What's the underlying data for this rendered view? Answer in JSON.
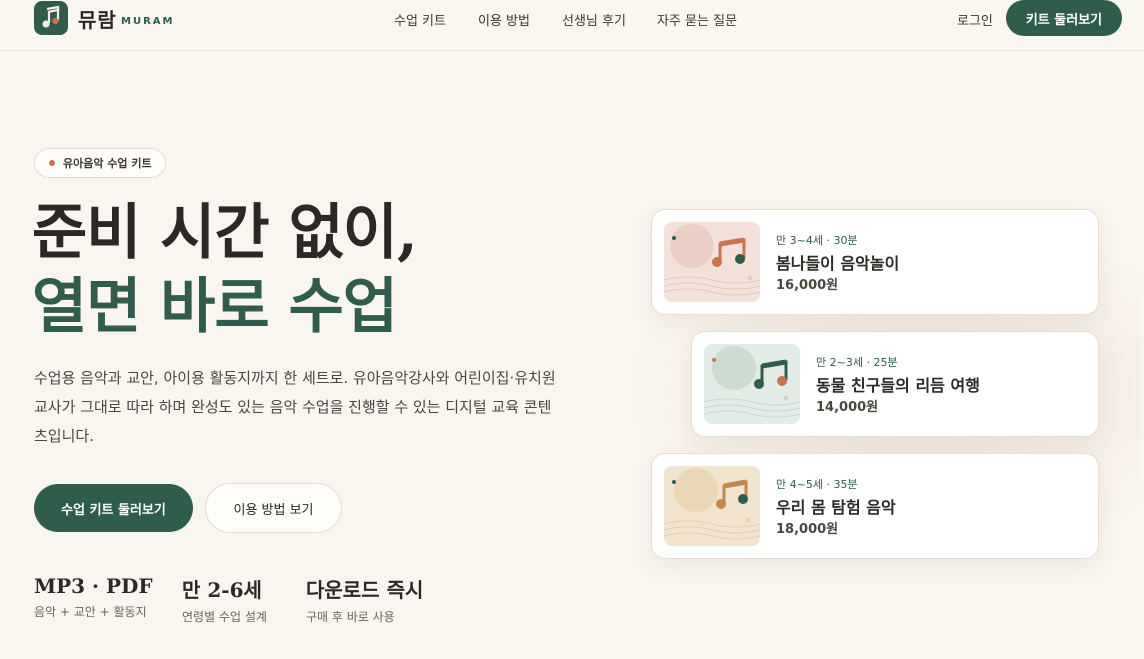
{
  "header": {
    "logo_text": "뮤람",
    "logo_sub": "MURAM",
    "nav": [
      "수업 키트",
      "이용 방법",
      "선생님 후기",
      "자주 묻는 질문"
    ],
    "login_label": "로그인",
    "cta_label": "키트 둘러보기"
  },
  "hero": {
    "badge": "유아음악 수업 키트",
    "title_line1": "준비 시간 없이,",
    "title_line2": "열면 바로 수업",
    "description": "수업용 음악과 교안, 아이용 활동지까지 한 세트로. 유아음악강사와 어린이집·유치원 교사가 그대로 따라 하며 완성도 있는 음악 수업을 진행할 수 있는 디지털 교육 콘텐츠입니다.",
    "primary_button": "수업 키트 둘러보기",
    "secondary_button": "이용 방법 보기",
    "stats": [
      {
        "value": "MP3 · PDF",
        "label": "음악 + 교안 + 활동지"
      },
      {
        "value": "만 2-6세",
        "label": "연령별 수업 설계"
      },
      {
        "value": "다운로드 즉시",
        "label": "구매 후 바로 사용"
      }
    ]
  },
  "products": [
    {
      "meta": "만 3~4세 · 30분",
      "title": "봄나들이 음악놀이",
      "price": "16,000원",
      "thumb_bg": "#f3e2da",
      "circle": "#ead0c4",
      "note": "#c9734f",
      "note2": "#2f5c4b",
      "dot": "#2f5c4b"
    },
    {
      "meta": "만 2~3세 · 25분",
      "title": "동물 친구들의 리듬 여행",
      "price": "14,000원",
      "thumb_bg": "#e3ebe6",
      "circle": "#cddbd2",
      "note": "#2f5c4b",
      "note2": "#c9734f",
      "dot": "#c9734f"
    },
    {
      "meta": "만 4~5세 · 35분",
      "title": "우리 몸 탐험 음악",
      "price": "18,000원",
      "thumb_bg": "#f1e4cf",
      "circle": "#ead7b8",
      "note": "#c08a4e",
      "note2": "#2f5c4b",
      "dot": "#2f5c4b"
    }
  ],
  "colors": {
    "brand": "#2f5c4b",
    "accent": "#c9734f",
    "background": "#f9f5ef"
  }
}
